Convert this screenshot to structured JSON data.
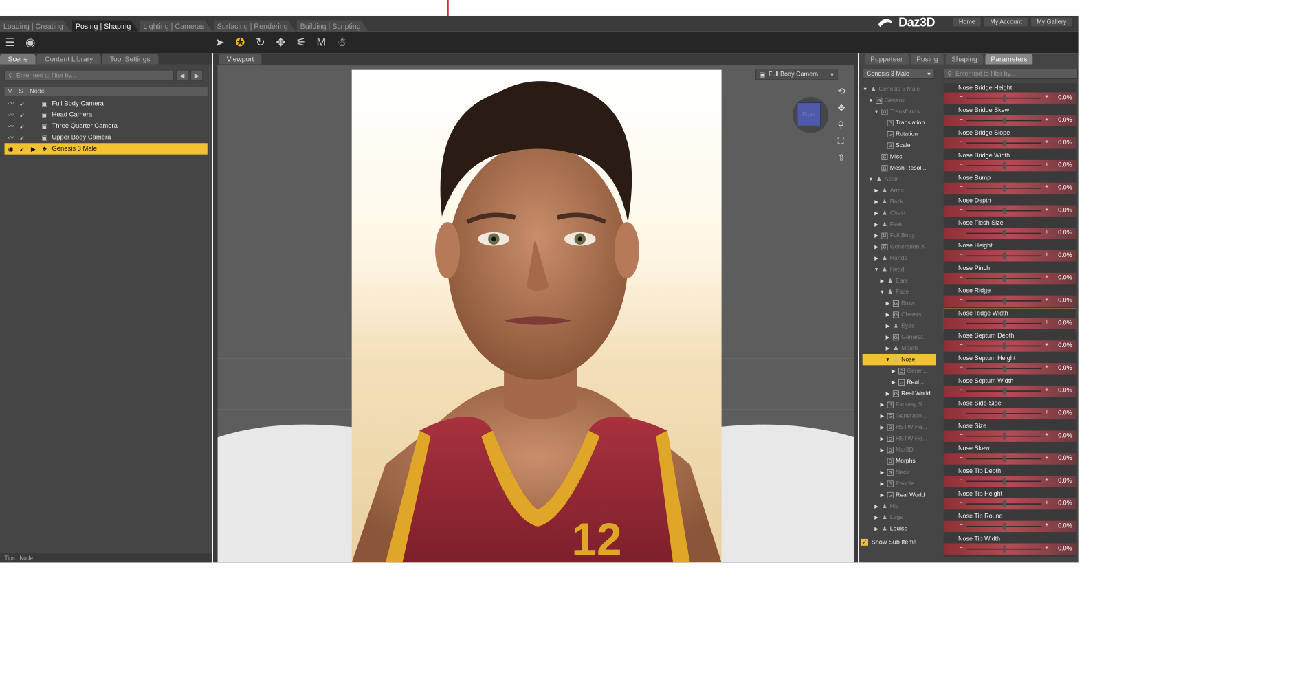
{
  "workspace_tabs": [
    "Loading | Creating",
    "Posing | Shaping",
    "Lighting | Cameras",
    "Surfacing | Rendering",
    "Building | Scripting"
  ],
  "brand": {
    "logo": "Daz3D",
    "links": [
      "Home",
      "My Account",
      "My Gallery"
    ]
  },
  "left_panel": {
    "tabs": [
      "Scene",
      "Content Library",
      "Tool Settings"
    ],
    "filter_placeholder": "Enter text to filter by...",
    "columns": [
      "V",
      "S",
      "Node"
    ],
    "nodes": [
      {
        "label": "Full Body Camera",
        "selected": false
      },
      {
        "label": "Head Camera",
        "selected": false
      },
      {
        "label": "Three Quarter Camera",
        "selected": false
      },
      {
        "label": "Upper Body Camera",
        "selected": false
      },
      {
        "label": "Genesis 3 Male",
        "selected": true
      }
    ]
  },
  "viewport": {
    "tab": "Viewport",
    "camera": "Full Body Camera",
    "cube_face": "Front",
    "jersey_number": "12"
  },
  "right_panel": {
    "tabs": [
      "Puppeteer",
      "Posing",
      "Shaping",
      "Parameters"
    ],
    "figure": "Genesis 3 Male",
    "filter_placeholder": "Enter text to filter by...",
    "tree": [
      {
        "label": "Genesis 3 Male",
        "depth": 0,
        "dim": true,
        "exp": "▼",
        "icon": "person"
      },
      {
        "label": "General",
        "depth": 1,
        "dim": true,
        "exp": "▼",
        "icon": "G"
      },
      {
        "label": "Transforms",
        "depth": 2,
        "dim": true,
        "exp": "▼",
        "icon": "G"
      },
      {
        "label": "Translation",
        "depth": 3,
        "dim": false,
        "exp": "",
        "icon": "G"
      },
      {
        "label": "Rotation",
        "depth": 3,
        "dim": false,
        "exp": "",
        "icon": "G"
      },
      {
        "label": "Scale",
        "depth": 3,
        "dim": false,
        "exp": "",
        "icon": "G"
      },
      {
        "label": "Misc",
        "depth": 2,
        "dim": false,
        "exp": "",
        "icon": "G"
      },
      {
        "label": "Mesh Resol...",
        "depth": 2,
        "dim": false,
        "exp": "",
        "icon": "G"
      },
      {
        "label": "Actor",
        "depth": 1,
        "dim": true,
        "exp": "▼",
        "icon": "person"
      },
      {
        "label": "Arms",
        "depth": 2,
        "dim": true,
        "exp": "▶",
        "icon": "person"
      },
      {
        "label": "Back",
        "depth": 2,
        "dim": true,
        "exp": "▶",
        "icon": "person"
      },
      {
        "label": "Chest",
        "depth": 2,
        "dim": true,
        "exp": "▶",
        "icon": "person"
      },
      {
        "label": "Feet",
        "depth": 2,
        "dim": true,
        "exp": "▶",
        "icon": "person"
      },
      {
        "label": "Full Body",
        "depth": 2,
        "dim": true,
        "exp": "▶",
        "icon": "G"
      },
      {
        "label": "Generation X",
        "depth": 2,
        "dim": true,
        "exp": "▶",
        "icon": "G"
      },
      {
        "label": "Hands",
        "depth": 2,
        "dim": true,
        "exp": "▶",
        "icon": "person"
      },
      {
        "label": "Head",
        "depth": 2,
        "dim": true,
        "exp": "▼",
        "icon": "person"
      },
      {
        "label": "Ears",
        "depth": 3,
        "dim": true,
        "exp": "▶",
        "icon": "person"
      },
      {
        "label": "Face",
        "depth": 3,
        "dim": true,
        "exp": "▼",
        "icon": "person"
      },
      {
        "label": "Brow",
        "depth": 4,
        "dim": true,
        "exp": "▶",
        "icon": "G"
      },
      {
        "label": "Cheeks ...",
        "depth": 4,
        "dim": true,
        "exp": "▶",
        "icon": "G"
      },
      {
        "label": "Eyes",
        "depth": 4,
        "dim": true,
        "exp": "▶",
        "icon": "person"
      },
      {
        "label": "Generat...",
        "depth": 4,
        "dim": true,
        "exp": "▶",
        "icon": "G"
      },
      {
        "label": "Mouth",
        "depth": 4,
        "dim": true,
        "exp": "▶",
        "icon": "person"
      },
      {
        "label": "Nose",
        "depth": 4,
        "dim": false,
        "exp": "▼",
        "icon": "person",
        "selected": true
      },
      {
        "label": "Gener...",
        "depth": 5,
        "dim": true,
        "exp": "▶",
        "icon": "G"
      },
      {
        "label": "Real ...",
        "depth": 5,
        "dim": false,
        "exp": "▶",
        "icon": "G"
      },
      {
        "label": "Real World",
        "depth": 4,
        "dim": false,
        "exp": "▶",
        "icon": "G"
      },
      {
        "label": "Fantasy S...",
        "depth": 3,
        "dim": true,
        "exp": "▶",
        "icon": "G"
      },
      {
        "label": "Generatio...",
        "depth": 3,
        "dim": true,
        "exp": "▶",
        "icon": "G"
      },
      {
        "label": "HSTW He...",
        "depth": 3,
        "dim": true,
        "exp": "▶",
        "icon": "G"
      },
      {
        "label": "HSTW He...",
        "depth": 3,
        "dim": true,
        "exp": "▶",
        "icon": "G"
      },
      {
        "label": "Mar3D",
        "depth": 3,
        "dim": true,
        "exp": "▶",
        "icon": "G"
      },
      {
        "label": "Morphs",
        "depth": 3,
        "dim": false,
        "exp": "",
        "icon": "G"
      },
      {
        "label": "Neck",
        "depth": 3,
        "dim": true,
        "exp": "▶",
        "icon": "G"
      },
      {
        "label": "People",
        "depth": 3,
        "dim": true,
        "exp": "▶",
        "icon": "G"
      },
      {
        "label": "Real World",
        "depth": 3,
        "dim": false,
        "exp": "▶",
        "icon": "G"
      },
      {
        "label": "Hip",
        "depth": 2,
        "dim": true,
        "exp": "▶",
        "icon": "person"
      },
      {
        "label": "Legs",
        "depth": 2,
        "dim": true,
        "exp": "▶",
        "icon": "person"
      },
      {
        "label": "Louise",
        "depth": 2,
        "dim": false,
        "exp": "▶",
        "icon": "person"
      }
    ],
    "show_sub_items": "Show Sub Items",
    "params": [
      {
        "name": "Nose Bridge Height",
        "value": "0.0%"
      },
      {
        "name": "Nose Bridge Skew",
        "value": "0.0%"
      },
      {
        "name": "Nose Bridge Slope",
        "value": "0.0%"
      },
      {
        "name": "Nose Bridge Width",
        "value": "0.0%"
      },
      {
        "name": "Nose Bump",
        "value": "0.0%"
      },
      {
        "name": "Nose Depth",
        "value": "0.0%"
      },
      {
        "name": "Nose Flesh Size",
        "value": "0.0%"
      },
      {
        "name": "Nose Height",
        "value": "0.0%"
      },
      {
        "name": "Nose Pinch",
        "value": "0.0%"
      },
      {
        "name": "Nose Ridge",
        "value": "0.0%"
      },
      {
        "name": "Nose Ridge Width",
        "value": "0.0%",
        "highlight": true
      },
      {
        "name": "Nose Septum Depth",
        "value": "0.0%"
      },
      {
        "name": "Nose Septum Height",
        "value": "0.0%"
      },
      {
        "name": "Nose Septum Width",
        "value": "0.0%"
      },
      {
        "name": "Nose Side-Side",
        "value": "0.0%"
      },
      {
        "name": "Nose Size",
        "value": "0.0%"
      },
      {
        "name": "Nose Skew",
        "value": "0.0%"
      },
      {
        "name": "Nose Tip Depth",
        "value": "0.0%"
      },
      {
        "name": "Nose Tip Height",
        "value": "0.0%"
      },
      {
        "name": "Nose Tip Round",
        "value": "0.0%"
      },
      {
        "name": "Nose Tip Width",
        "value": "0.0%"
      }
    ]
  },
  "bottom_tabs": [
    "Tips",
    "Node"
  ]
}
